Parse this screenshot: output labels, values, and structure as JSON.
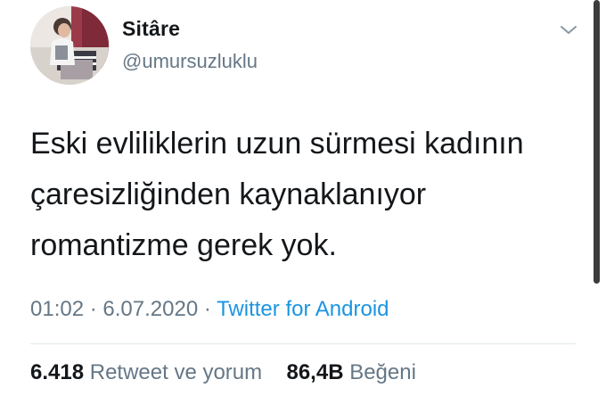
{
  "user": {
    "display_name": "Sitâre",
    "handle": "@umursuzluklu"
  },
  "icons": {
    "avatar": "profile-photo",
    "menu": "chevron-down-icon"
  },
  "tweet": {
    "lines": [
      "Eski evliliklerin uzun sürmesi kadının",
      "çaresizliğinden kaynaklanıyor",
      "romantizme gerek yok."
    ],
    "time": "01:02",
    "separator": "·",
    "date": "6.07.2020",
    "source": "Twitter for Android"
  },
  "stats": {
    "retweets_count": "6.418",
    "retweets_label": "Retweet ve yorum",
    "likes_count": "86,4B",
    "likes_label": "Beğeni"
  },
  "colors": {
    "text": "#14171a",
    "secondary": "#657786",
    "link": "#1b95e0",
    "divider": "#e1e8ed"
  }
}
